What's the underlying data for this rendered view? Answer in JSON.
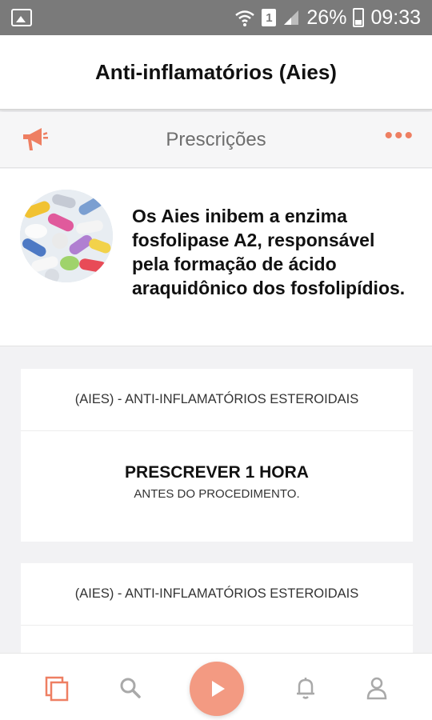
{
  "status_bar": {
    "battery": "26%",
    "time": "09:33",
    "sim": "1"
  },
  "header": {
    "title": "Anti-inflamatórios (Aies)"
  },
  "sub_bar": {
    "title": "Prescrições",
    "more": "•••"
  },
  "intro": {
    "text": "Os Aies inibem a enzima fosfolipase A2, responsável pela formação de ácido araquidônico dos fosfolipídios."
  },
  "cards": [
    {
      "header": "(AIES) - ANTI-INFLAMATÓRIOS ESTEROIDAIS",
      "title": "PRESCREVER 1 HORA",
      "subtitle": "ANTES DO PROCEDIMENTO."
    },
    {
      "header": "(AIES) - ANTI-INFLAMATÓRIOS ESTEROIDAIS"
    }
  ],
  "theme": {
    "accent": "#ee7f62",
    "play": "#f39a82"
  },
  "nav": {
    "items": [
      "copy-icon",
      "search-icon",
      "play-icon",
      "bell-icon",
      "user-icon"
    ]
  }
}
